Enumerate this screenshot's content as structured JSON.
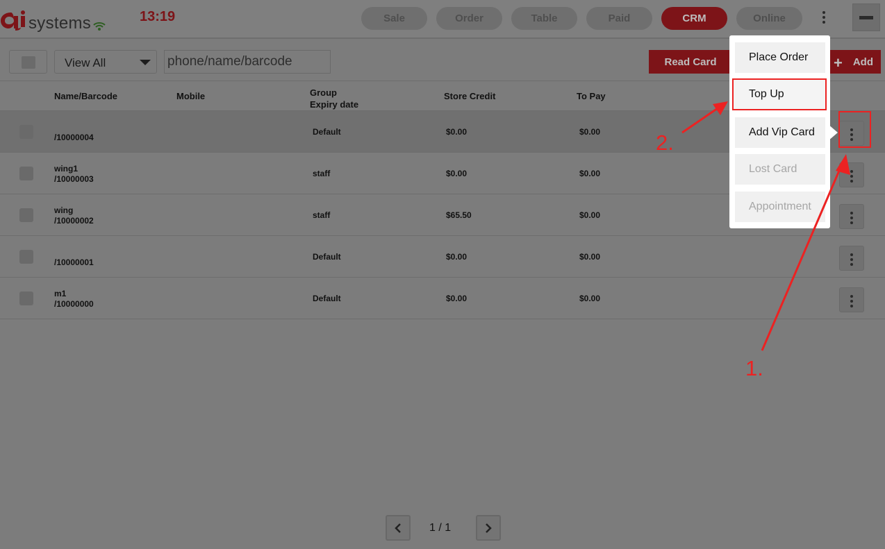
{
  "header": {
    "logo_text": "systems",
    "clock": "13:19",
    "nav": [
      {
        "label": "Sale",
        "active": false
      },
      {
        "label": "Order",
        "active": false
      },
      {
        "label": "Table",
        "active": false
      },
      {
        "label": "Paid",
        "active": false
      },
      {
        "label": "CRM",
        "active": true
      },
      {
        "label": "Online",
        "active": false
      }
    ]
  },
  "toolbar": {
    "filter_selected": "View All",
    "search_placeholder": "phone/name/barcode",
    "read_card_label": "Read Card",
    "add_label": "Add"
  },
  "table": {
    "headers": {
      "name": "Name/Barcode",
      "mobile": "Mobile",
      "group": "Group",
      "expiry": "Expiry date",
      "store_credit": "Store Credit",
      "to_pay": "To Pay"
    },
    "rows": [
      {
        "name": "",
        "barcode": "/10000004",
        "mobile": "",
        "group": "Default",
        "store_credit": "$0.00",
        "to_pay": "$0.00"
      },
      {
        "name": "wing1",
        "barcode": "/10000003",
        "mobile": "",
        "group": "staff",
        "store_credit": "$0.00",
        "to_pay": "$0.00"
      },
      {
        "name": "wing",
        "barcode": "/10000002",
        "mobile": "",
        "group": "staff",
        "store_credit": "$65.50",
        "to_pay": "$0.00"
      },
      {
        "name": "",
        "barcode": "/10000001",
        "mobile": "",
        "group": "Default",
        "store_credit": "$0.00",
        "to_pay": "$0.00"
      },
      {
        "name": "m1",
        "barcode": "/10000000",
        "mobile": "",
        "group": "Default",
        "store_credit": "$0.00",
        "to_pay": "$0.00"
      }
    ]
  },
  "pagination": {
    "label": "1 / 1"
  },
  "popup_menu": {
    "items": [
      {
        "label": "Place Order",
        "enabled": true
      },
      {
        "label": "Top Up",
        "enabled": true
      },
      {
        "label": "Add Vip Card",
        "enabled": true
      },
      {
        "label": "Lost Card",
        "enabled": false
      },
      {
        "label": "Appointment",
        "enabled": false
      }
    ]
  },
  "annotations": {
    "step1": "1.",
    "step2": "2.",
    "color": "#ec2222"
  },
  "colors": {
    "brand_red": "#b81d24",
    "overlay_gray": "#7c7c7c",
    "annotation_red": "#ec2222"
  }
}
